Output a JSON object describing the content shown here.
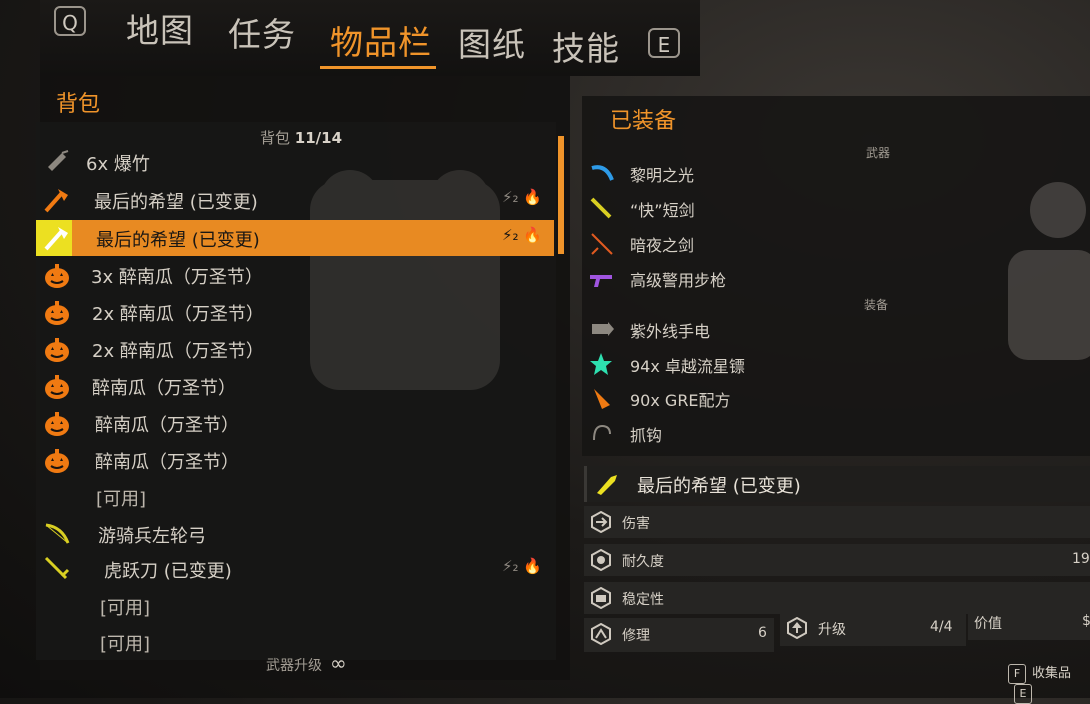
{
  "tabs": {
    "left_key": "Q",
    "items": [
      "地图",
      "任务",
      "物品栏",
      "图纸",
      "技能"
    ],
    "active": "物品栏",
    "right_key": "E"
  },
  "backpack": {
    "title": "背包",
    "count_label": "背包",
    "count": "11/14",
    "items": [
      {
        "label": "6x 爆竹",
        "icon": "firecracker-icon"
      },
      {
        "label": "最后的希望 (已变更)",
        "icon": "axe-icon",
        "perks": "⚡₂ 🔥"
      },
      {
        "label": "最后的希望 (已变更)",
        "icon": "axe-icon",
        "perks": "⚡₂ 🔥",
        "selected": true
      },
      {
        "label": "3x 醉南瓜（万圣节）",
        "icon": "pumpkin-icon"
      },
      {
        "label": "2x 醉南瓜（万圣节）",
        "icon": "pumpkin-icon"
      },
      {
        "label": "2x 醉南瓜（万圣节）",
        "icon": "pumpkin-icon"
      },
      {
        "label": "醉南瓜（万圣节）",
        "icon": "pumpkin-icon"
      },
      {
        "label": "醉南瓜（万圣节）",
        "icon": "pumpkin-icon"
      },
      {
        "label": "醉南瓜（万圣节）",
        "icon": "pumpkin-icon"
      },
      {
        "label": "[可用]",
        "icon": ""
      },
      {
        "label": "游骑兵左轮弓",
        "icon": "bow-icon"
      },
      {
        "label": "虎跃刀 (已变更)",
        "icon": "blade-icon",
        "perks": "⚡₂ 🔥"
      },
      {
        "label": "[可用]",
        "icon": ""
      },
      {
        "label": "[可用]",
        "icon": ""
      }
    ],
    "upgrade_label": "武器升级",
    "upgrade_value": "∞"
  },
  "equipped": {
    "title": "已装备",
    "weapons_section": "武器",
    "weapons": [
      "黎明之光",
      "“快”短剑",
      "暗夜之剑",
      "高级警用步枪"
    ],
    "gear_section": "装备",
    "gear": [
      "紫外线手电",
      "94x 卓越流星镖",
      "90x GRE配方",
      "抓钩"
    ]
  },
  "detail": {
    "name": "最后的希望 (已变更)",
    "stats": [
      "伤害",
      "耐久度",
      "稳定性"
    ],
    "durability_value": "19",
    "repair_label": "修理",
    "repair_value": "6",
    "upgrade_label": "升级",
    "upgrade_value": "4/4",
    "price_label": "价值",
    "price_value": "$"
  },
  "footer": {
    "key": "F",
    "label": "收集品",
    "right_key": "E"
  },
  "colors": {
    "accent": "#f0942a",
    "selected_row": "#e88a22",
    "pumpkin": "#f07a12"
  }
}
